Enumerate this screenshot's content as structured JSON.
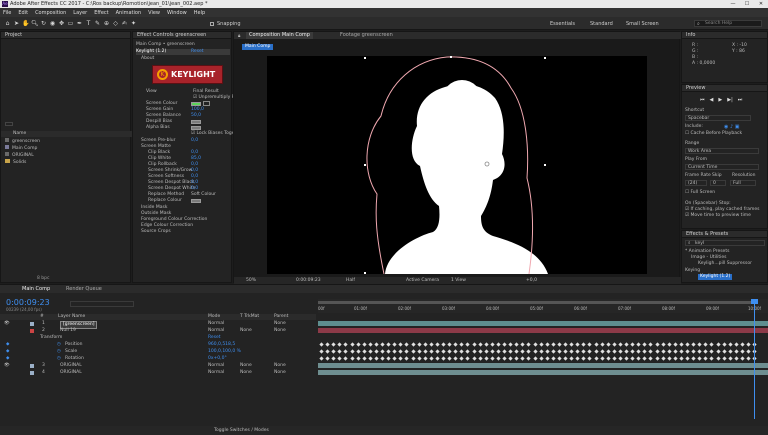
{
  "window": {
    "title": "Adobe After Effects CC 2017 - C:\\Ros backup\\Romotion\\jean_01\\jean_002.aep *",
    "min": "—",
    "max": "☐",
    "close": "✕"
  },
  "menu": [
    "File",
    "Edit",
    "Composition",
    "Layer",
    "Effect",
    "Animation",
    "View",
    "Window",
    "Help"
  ],
  "toolbar": {
    "snapping": "Snapping",
    "workspaces": [
      "Essentials",
      "Standard",
      "Small Screen"
    ],
    "search_placeholder": "Search Help"
  },
  "project": {
    "tab": "Project",
    "col_name": "Name",
    "items": [
      "greenscreen",
      "Main Comp",
      "ORIGINAL",
      "Solids"
    ],
    "bpc": "8 bpc"
  },
  "effect_controls": {
    "tab": "Effect Controls greenscreen",
    "breadcrumb": "Main Comp • greenscreen",
    "effect": "Keylight (1.2)",
    "reset": "Reset",
    "about": "About",
    "logo_text": "KEYLIGHT",
    "view_label": "View",
    "view_value": "Final Result",
    "unpremultiply": "Unpremultiply Result",
    "params": [
      {
        "label": "Screen Colour",
        "value": ""
      },
      {
        "label": "Screen Gain",
        "value": "100,0"
      },
      {
        "label": "Screen Balance",
        "value": "50,0"
      },
      {
        "label": "Despill Bias",
        "value": ""
      },
      {
        "label": "Alpha Bias",
        "value": ""
      },
      {
        "label": "",
        "value": "Lock Biases Together"
      },
      {
        "label": "Screen Pre-blur",
        "value": "0,0"
      },
      {
        "label": "Screen Matte",
        "value": ""
      },
      {
        "label": "Clip Black",
        "value": "0,0"
      },
      {
        "label": "Clip White",
        "value": "85,0"
      },
      {
        "label": "Clip Rollback",
        "value": "0,0"
      },
      {
        "label": "Screen Shrink/Grow",
        "value": "0,0"
      },
      {
        "label": "Screen Softness",
        "value": "0,0"
      },
      {
        "label": "Screen Despot Black",
        "value": "0,0"
      },
      {
        "label": "Screen Despot White",
        "value": "0,0"
      },
      {
        "label": "Replace Method",
        "value": "Soft Colour"
      },
      {
        "label": "Replace Colour",
        "value": ""
      }
    ],
    "groups": [
      "Inside Mask",
      "Outside Mask",
      "Foreground Colour Correction",
      "Edge Colour Correction",
      "Source Crops"
    ]
  },
  "comp": {
    "tab_comp": "Composition Main Comp",
    "tab_footage": "Footage greenscreen",
    "sub_tab": "Main Comp",
    "zoom": "50%",
    "time": "0:00:09:23",
    "resolution": "Half",
    "camera": "Active Camera",
    "views": "1 View",
    "offset": "+0,0"
  },
  "info": {
    "tab": "Info",
    "r": "R :",
    "g": "G :",
    "b": "B :",
    "a": "A : 0,0000",
    "x": "X : -10",
    "y": "Y : 86"
  },
  "preview": {
    "tab": "Preview",
    "shortcut_label": "Shortcut",
    "shortcut": "Spacebar",
    "include": "Include:",
    "cache": "Cache Before Playback",
    "range_label": "Range",
    "range": "Work Area",
    "playfrom_label": "Play From",
    "playfrom": "Current Time",
    "fr_label": "Frame Rate",
    "skip_label": "Skip",
    "res_label": "Resolution",
    "fr": "(24)",
    "skip": "0",
    "res": "Full",
    "fullscreen": "Full Screen",
    "onstop": "On (Spacebar) Stop:",
    "cached": "If caching, play cached frames",
    "movetime": "Move time to preview time"
  },
  "effects_presets": {
    "tab": "Effects & Presets",
    "search": "keyl",
    "items": [
      "* Animation Presets",
      "Image - Utilities",
      "Keyligh...pill Suppressor",
      "Keying",
      "Keylight (1.2)"
    ]
  },
  "timeline": {
    "tab": "Main Comp",
    "tab2": "Render Queue",
    "time": "0:00:09:23",
    "frames": "00239 (24,00 fps)",
    "cols": [
      "#",
      "Layer Name",
      "Mode",
      "T TrkMat",
      "Parent"
    ],
    "layers": [
      {
        "num": "1",
        "name": "[greenscreen]",
        "mode": "Normal",
        "trk": "",
        "parent": "None"
      },
      {
        "num": "2",
        "name": "Null 19",
        "mode": "Normal",
        "trk": "None",
        "parent": "None"
      },
      {
        "num": "",
        "name": "Transform",
        "mode": "Reset",
        "trk": "",
        "parent": ""
      },
      {
        "num": "",
        "name": "Position",
        "mode": "960,0,518,5",
        "trk": "",
        "parent": ""
      },
      {
        "num": "",
        "name": "Scale",
        "mode": "100,0,100,0 %",
        "trk": "",
        "parent": ""
      },
      {
        "num": "",
        "name": "Rotation",
        "mode": "0x+0,0°",
        "trk": "",
        "parent": ""
      },
      {
        "num": "3",
        "name": "ORIGINAL",
        "mode": "Normal",
        "trk": "None",
        "parent": "None"
      },
      {
        "num": "4",
        "name": "ORIGINAL",
        "mode": "Normal",
        "trk": "None",
        "parent": "None"
      }
    ],
    "ruler": [
      "00f",
      "01:00f",
      "02:00f",
      "03:00f",
      "04:00f",
      "05:00f",
      "06:00f",
      "07:00f",
      "08:00f",
      "09:00f",
      "10:00f"
    ],
    "toggle": "Toggle Switches / Modes"
  }
}
